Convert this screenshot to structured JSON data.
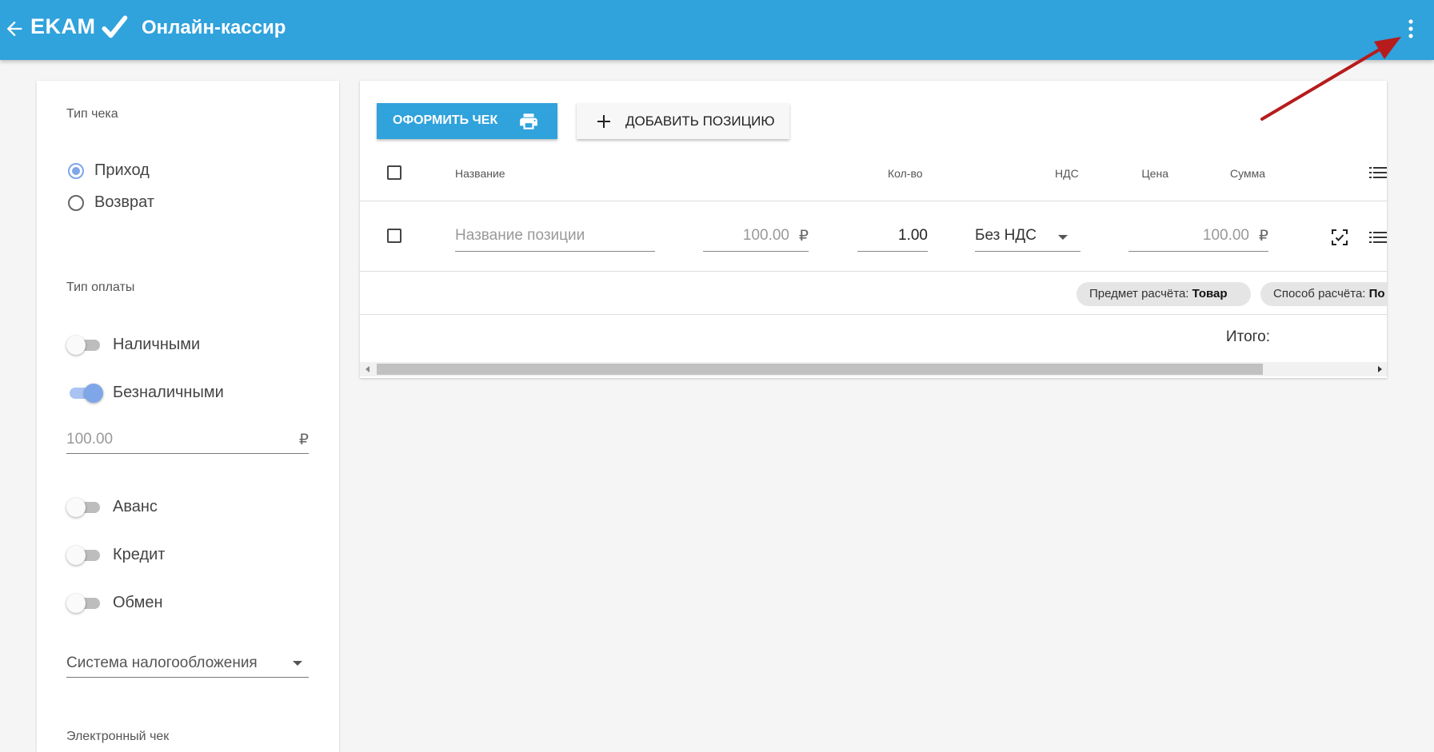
{
  "topbar": {
    "brand": "EKAM",
    "title": "Онлайн-кассир",
    "color": "#30a2dc",
    "icons": [
      "arrow-back-icon",
      "checkmark-icon",
      "more-vertical-icon"
    ]
  },
  "left_panel": {
    "receipt_type": {
      "label": "Тип чека",
      "options": [
        {
          "label": "Приход",
          "selected": true
        },
        {
          "label": "Возврат",
          "selected": false
        }
      ]
    },
    "payment_type": {
      "label": "Тип оплаты",
      "cash": {
        "label": "Наличными",
        "on": false
      },
      "card": {
        "label": "Безналичными",
        "on": true
      },
      "amount": "100.00",
      "currency": "₽",
      "advance": {
        "label": "Аванс",
        "on": false
      },
      "credit": {
        "label": "Кредит",
        "on": false
      },
      "exchange": {
        "label": "Обмен",
        "on": false
      }
    },
    "tax_system": {
      "placeholder": "Система налогообложения"
    },
    "e_receipt": {
      "label": "Электронный чек"
    }
  },
  "toolbar": {
    "issue_label": "ОФОРМИТЬ ЧЕК",
    "add_label": "ДОБАВИТЬ ПОЗИЦИЮ"
  },
  "table": {
    "headers": {
      "name": "Название",
      "price": "Цена",
      "qty": "Кол-во",
      "vat": "НДС",
      "sum": "Сумма"
    },
    "row": {
      "name_placeholder": "Название позиции",
      "price": "100.00",
      "qty": "1.00",
      "vat": "Без НДС",
      "sum": "100.00",
      "currency": "₽"
    },
    "chips": {
      "subject_label": "Предмет расчёта:",
      "subject_value": "Товар",
      "method_label": "Способ расчёта:",
      "method_value": "По"
    },
    "total_label": "Итого:"
  },
  "annotation": {
    "arrow_color": "#b71c1c"
  }
}
